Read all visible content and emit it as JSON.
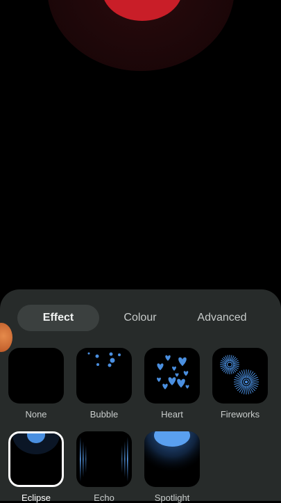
{
  "tabs": [
    {
      "label": "Effect",
      "active": true
    },
    {
      "label": "Colour",
      "active": false
    },
    {
      "label": "Advanced",
      "active": false
    }
  ],
  "effects": [
    {
      "label": "None",
      "icon": "none-effect-icon",
      "selected": false
    },
    {
      "label": "Bubble",
      "icon": "bubble-effect-icon",
      "selected": false
    },
    {
      "label": "Heart",
      "icon": "heart-effect-icon",
      "selected": false
    },
    {
      "label": "Fireworks",
      "icon": "fireworks-effect-icon",
      "selected": false
    },
    {
      "label": "Eclipse",
      "icon": "eclipse-effect-icon",
      "selected": true
    },
    {
      "label": "Echo",
      "icon": "echo-effect-icon",
      "selected": false
    },
    {
      "label": "Spotlight",
      "icon": "spotlight-effect-icon",
      "selected": false
    }
  ],
  "colors": {
    "accent_blue": "#4a8fe0",
    "preview_red": "#c91e28",
    "sheet_bg": "#272b2a",
    "active_tab_bg": "#3b403f",
    "side_knob": "#d67438"
  }
}
